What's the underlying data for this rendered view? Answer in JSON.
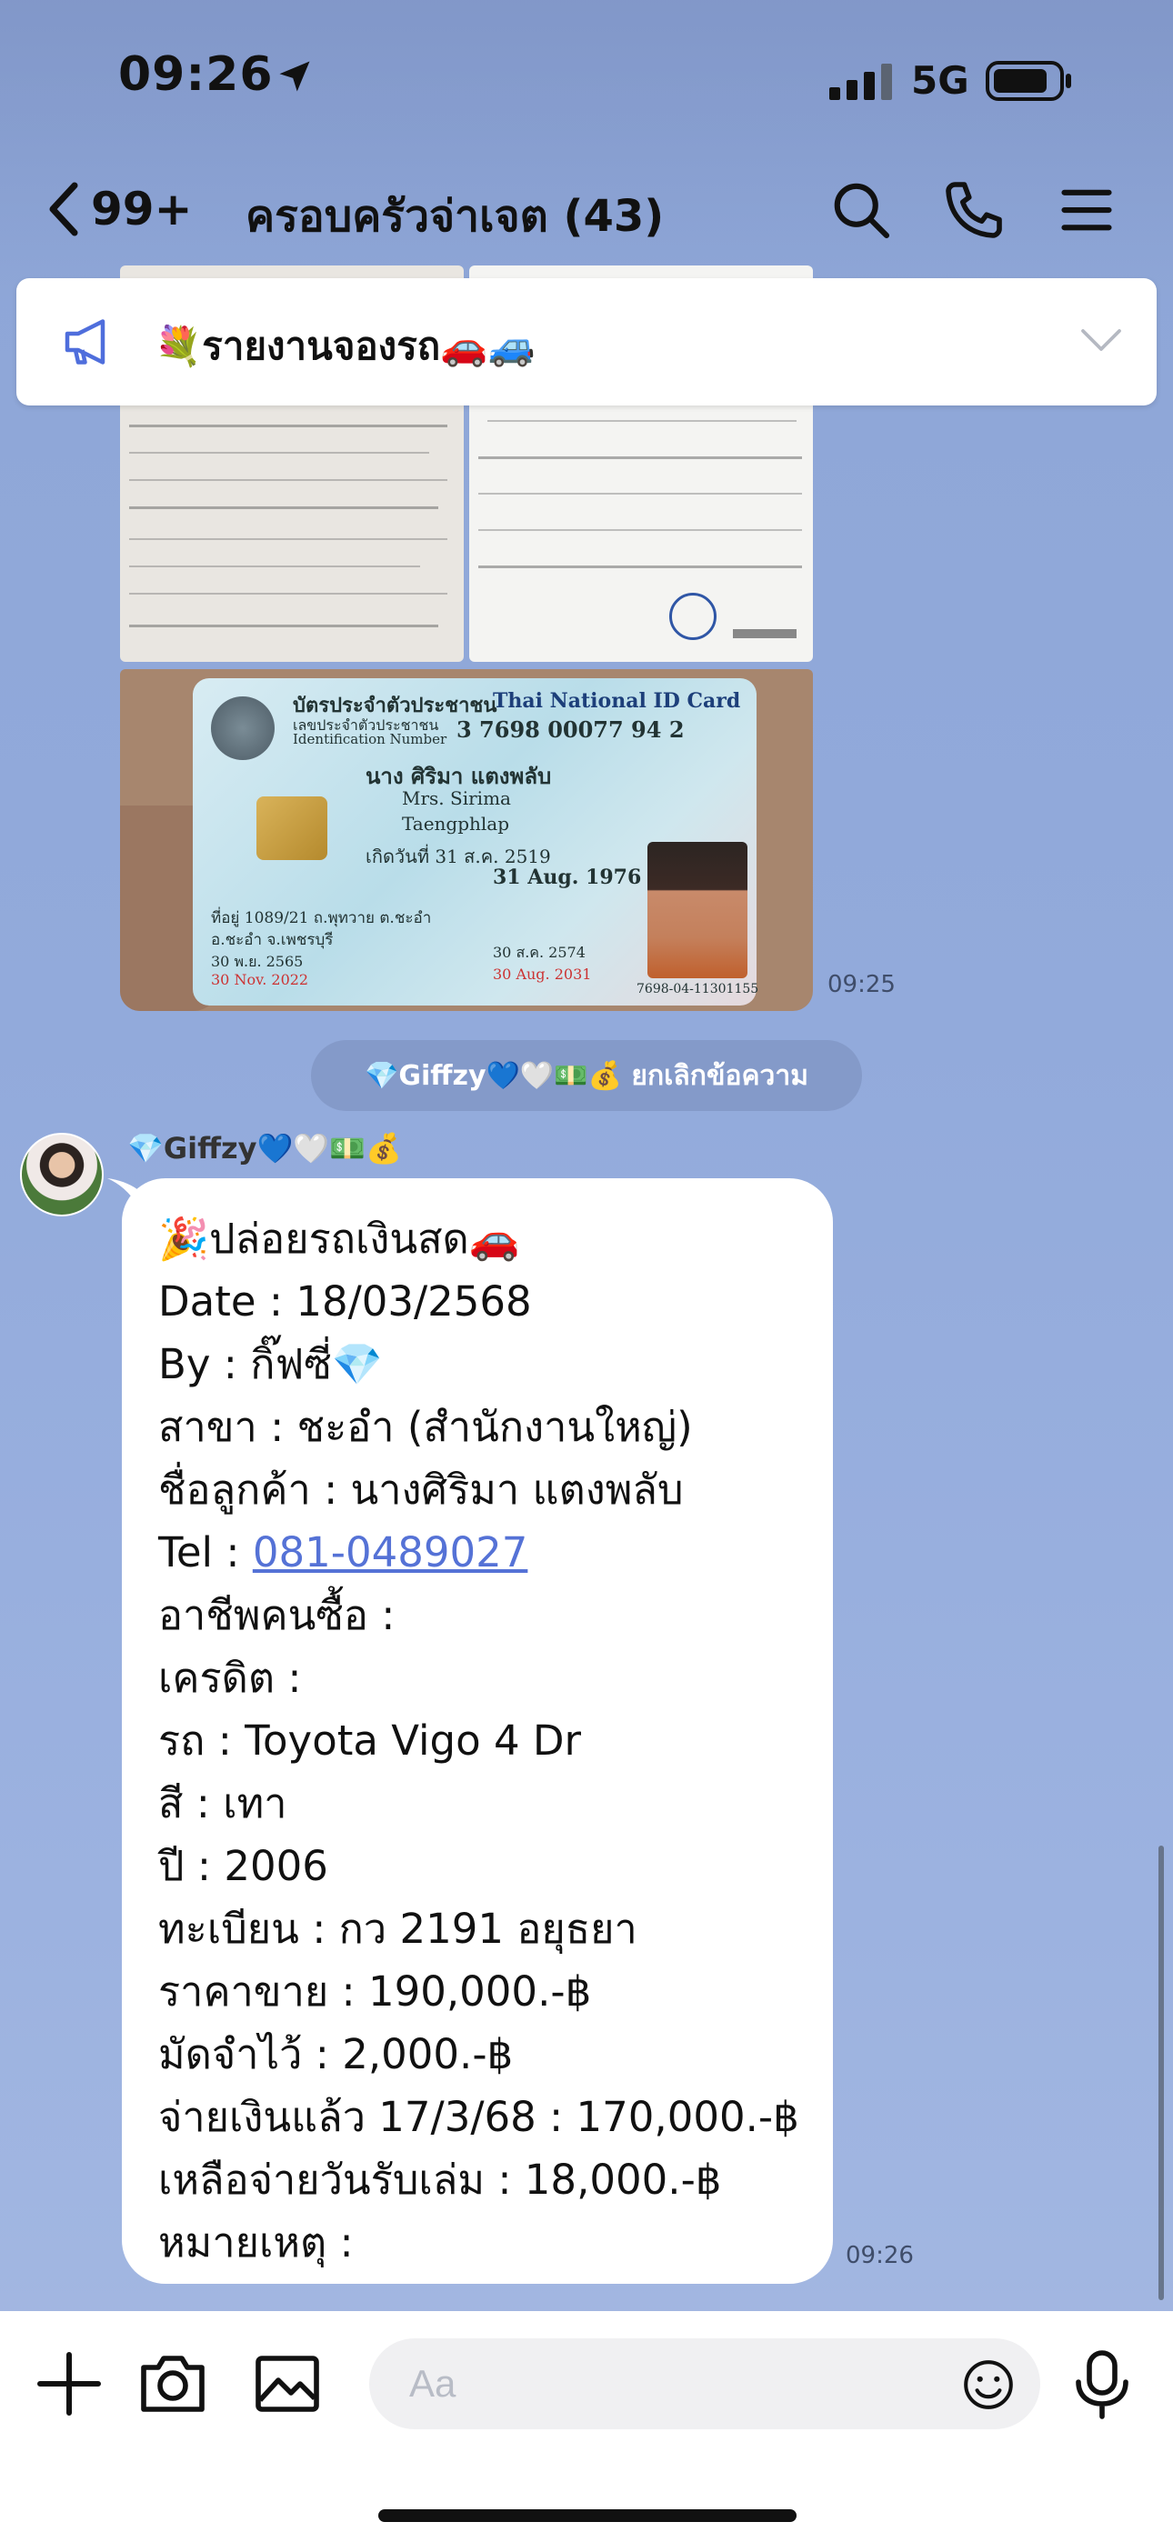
{
  "status_bar": {
    "time": "09:26",
    "network": "5G"
  },
  "header": {
    "unread_count": "99+",
    "title": "ครอบครัวจ่าเจต (43)",
    "icons": [
      "search-icon",
      "phone-icon",
      "menu-icon"
    ]
  },
  "announcement": {
    "text": "💐รายงานจองรถ🚗🚙"
  },
  "photos": {
    "idcard": {
      "title_th": "บัตรประจำตัวประชาชน",
      "title_en": "Thai National ID Card",
      "id_label_th": "เลขประจำตัวประชาชน",
      "id_label_en": "Identification Number",
      "id_number": "3 7698 00077 94 2",
      "name_th": "นาง ศิริมา แตงพลับ",
      "name_en": "Mrs. Sirima",
      "lastname_en": "Taengphlap",
      "dob_th": "เกิดวันที่ 31 ส.ค. 2519",
      "dob_en": "31 Aug. 1976",
      "address": "ที่อยู่ 1089/21 ถ.พุทวาย ต.ชะอำ",
      "address2": "อ.ชะอำ จ.เพชรบุรี",
      "issue_th": "30 พ.ย. 2565",
      "issue_en": "30 Nov. 2022",
      "expiry_th": "30 ส.ค. 2574",
      "expiry_en": "30 Aug. 2031",
      "serial": "7698-04-11301155"
    },
    "time": "09:25"
  },
  "system_notice": {
    "text": "💎Giffzy💙🤍💵💰 ยกเลิกข้อความ"
  },
  "message": {
    "sender": "💎Giffzy💙🤍💵💰",
    "time": "09:26",
    "lines": [
      "🎉ปล่อยรถเงินสด🚗",
      "Date : 18/03/2568",
      "By : กิ๊ฟซี่💎",
      "สาขา : ชะอำ (สำนักงานใหญ่)",
      "ชื่อลูกค้า : นางศิริมา แตงพลับ",
      "Tel : ",
      "อาชีพคนซื้อ :",
      "เครดิต :",
      "รถ : Toyota Vigo 4 Dr",
      "สี : เทา",
      "ปี : 2006",
      "ทะเบียน : กว 2191 อยุธยา",
      "ราคาขาย : 190,000.-฿",
      "มัดจำไว้ : 2,000.-฿",
      "จ่ายเงินแล้ว 17/3/68 : 170,000.-฿",
      "เหลือจ่ายวันรับเล่ม : 18,000.-฿",
      "หมายเหตุ :"
    ],
    "tel_link": "081-0489027"
  },
  "composer": {
    "placeholder": "Aa"
  }
}
